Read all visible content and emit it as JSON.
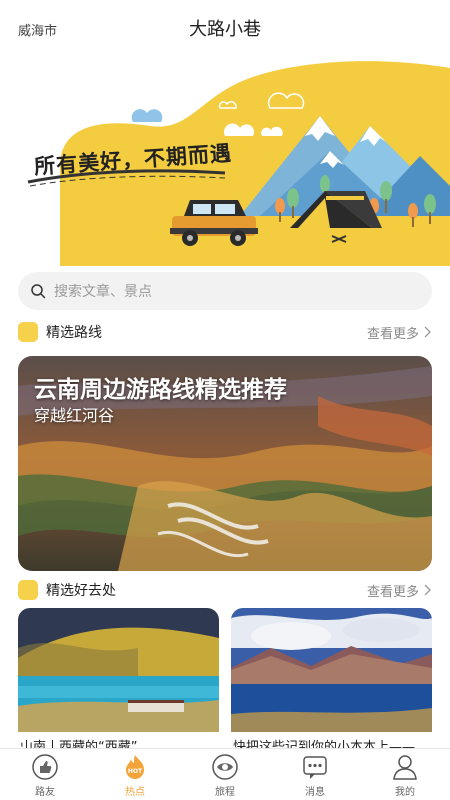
{
  "header": {
    "city": "威海市",
    "title": "大路小巷"
  },
  "hero": {
    "slogan": "所有美好，不期而遇"
  },
  "search": {
    "placeholder": "搜索文章、景点"
  },
  "routes": {
    "title": "精选路线",
    "more": "查看更多"
  },
  "route_card": {
    "title": "云南周边游路线精选推荐",
    "subtitle": "穿越红河谷"
  },
  "places": {
    "title": "精选好去处",
    "more": "查看更多",
    "items": [
      {
        "caption": "山南丨西藏的“西藏”"
      },
      {
        "caption": "快把这些记到你的小本本上——"
      }
    ]
  },
  "tabbar": {
    "items": [
      {
        "label": "路友",
        "icon": "thumbs-up-icon"
      },
      {
        "label": "热点",
        "icon": "hot-flame-icon",
        "badge": "HOT"
      },
      {
        "label": "旅程",
        "icon": "eye-icon"
      },
      {
        "label": "消息",
        "icon": "message-icon"
      },
      {
        "label": "我的",
        "icon": "profile-icon"
      }
    ]
  },
  "colors": {
    "accent": "#f6d24c",
    "active_tab": "#f2a33a"
  }
}
